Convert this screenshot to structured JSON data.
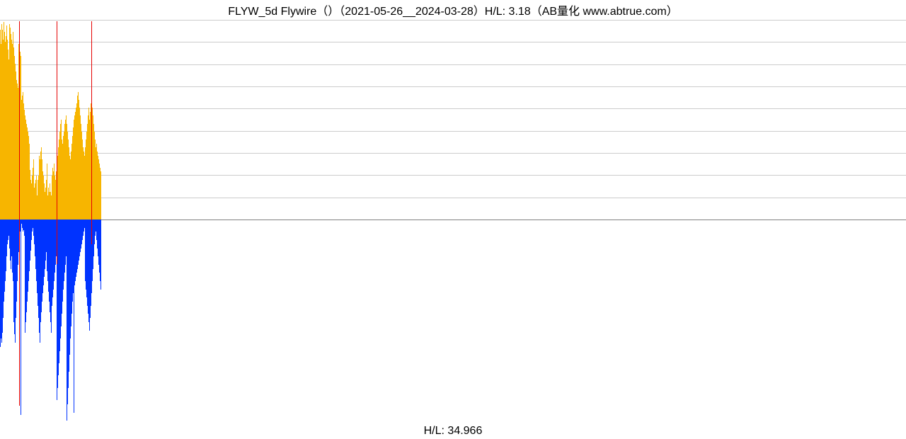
{
  "title": "FLYW_5d Flywire（）（2021-05-26__2024-03-28）H/L: 3.18（AB量化  www.abtrue.com）",
  "footer": "H/L: 34.966",
  "colors": {
    "up_bar": "#f7b500",
    "down_bar": "#0033ff",
    "mark": "#e60000",
    "grid": "#cccccc",
    "baseline": "#808080"
  },
  "chart_data": {
    "type": "bar",
    "title": "FLYW_5d Flywire（）（2021-05-26__2024-03-28）H/L: 3.18（AB量化  www.abtrue.com）",
    "xlabel": "",
    "ylabel": "",
    "hl_ratio_top": 3.18,
    "hl_ratio_bottom": 34.966,
    "grid_levels_upper": [
      0,
      0.111,
      0.222,
      0.333,
      0.444,
      0.556,
      0.667,
      0.778,
      0.889,
      1.0
    ],
    "x_range_bars": 148,
    "data_extent_bars": 143,
    "full_width_bars": 1280,
    "series": [
      {
        "name": "upper",
        "color": "#f7b500",
        "note": "column heights as fraction of upper-panel height; bars grow up from the midline",
        "values": [
          0.95,
          0.88,
          0.98,
          0.95,
          0.9,
          0.99,
          0.94,
          0.89,
          0.92,
          0.97,
          0.9,
          0.85,
          0.8,
          0.98,
          0.96,
          0.93,
          0.9,
          0.88,
          0.94,
          0.86,
          0.82,
          0.78,
          0.74,
          0.7,
          0.68,
          0.66,
          0.88,
          0.86,
          0.84,
          0.82,
          0.6,
          0.62,
          0.64,
          0.58,
          0.55,
          0.52,
          0.5,
          0.48,
          0.46,
          0.44,
          0.42,
          0.38,
          0.25,
          0.2,
          0.18,
          0.22,
          0.26,
          0.3,
          0.16,
          0.18,
          0.2,
          0.22,
          0.12,
          0.2,
          0.22,
          0.32,
          0.3,
          0.34,
          0.36,
          0.3,
          0.24,
          0.22,
          0.18,
          0.14,
          0.16,
          0.2,
          0.28,
          0.12,
          0.16,
          0.14,
          0.18,
          0.14,
          0.12,
          0.22,
          0.26,
          0.24,
          0.28,
          0.22,
          0.2,
          0.24,
          0.28,
          0.32,
          0.36,
          0.4,
          0.44,
          0.48,
          0.5,
          0.4,
          0.38,
          0.42,
          0.44,
          0.48,
          0.5,
          0.52,
          0.48,
          0.44,
          0.4,
          0.36,
          0.32,
          0.3,
          0.34,
          0.38,
          0.42,
          0.46,
          0.5,
          0.52,
          0.54,
          0.56,
          0.58,
          0.62,
          0.64,
          0.6,
          0.56,
          0.52,
          0.48,
          0.44,
          0.4,
          0.36,
          0.34,
          0.32,
          0.36,
          0.4,
          0.44,
          0.48,
          0.52,
          0.56,
          0.5,
          0.54,
          0.58,
          0.6,
          0.56,
          0.52,
          0.48,
          0.44,
          0.4,
          0.36,
          0.38,
          0.34,
          0.32,
          0.3,
          0.28,
          0.26,
          0.24
        ]
      },
      {
        "name": "lower",
        "color": "#0033ff",
        "note": "column depths as fraction of lower-panel height; bars hang down from the midline",
        "values": [
          0.62,
          0.58,
          0.6,
          0.55,
          0.48,
          0.4,
          0.35,
          0.3,
          0.25,
          0.18,
          0.12,
          0.1,
          0.08,
          0.14,
          0.2,
          0.24,
          0.18,
          0.26,
          0.3,
          0.5,
          0.56,
          0.6,
          0.48,
          0.4,
          0.3,
          0.22,
          0.16,
          0.12,
          0.06,
          0.95,
          0.02,
          0.04,
          0.06,
          0.05,
          0.08,
          0.55,
          0.5,
          0.45,
          0.4,
          0.35,
          0.3,
          0.25,
          0.2,
          0.15,
          0.1,
          0.06,
          0.04,
          0.08,
          0.12,
          0.18,
          0.24,
          0.3,
          0.36,
          0.42,
          0.48,
          0.55,
          0.6,
          0.5,
          0.45,
          0.4,
          0.36,
          0.32,
          0.28,
          0.24,
          0.2,
          0.16,
          0.25,
          0.3,
          0.35,
          0.4,
          0.45,
          0.5,
          0.55,
          0.42,
          0.38,
          0.34,
          0.3,
          0.26,
          0.22,
          0.18,
          0.88,
          0.82,
          0.76,
          0.7,
          0.64,
          0.58,
          0.52,
          0.46,
          0.4,
          0.34,
          0.3,
          0.26,
          0.22,
          0.18,
          0.98,
          0.9,
          0.82,
          0.74,
          0.66,
          0.58,
          0.52,
          0.46,
          0.4,
          0.36,
          0.94,
          0.32,
          0.3,
          0.28,
          0.26,
          0.24,
          0.22,
          0.2,
          0.18,
          0.16,
          0.14,
          0.12,
          0.1,
          0.08,
          0.06,
          0.04,
          0.3,
          0.34,
          0.38,
          0.42,
          0.46,
          0.5,
          0.54,
          0.48,
          0.42,
          0.36,
          0.3,
          0.24,
          0.18,
          0.12,
          0.08,
          0.06,
          0.1,
          0.14,
          0.18,
          0.22,
          0.26,
          0.3,
          0.34
        ]
      },
      {
        "name": "marks",
        "color": "#e60000",
        "note": "indices where a red marker line appears, with fraction of full chart height (top-to-bottom extent)",
        "indices": [
          27,
          80,
          129
        ],
        "extent": [
          0.95,
          0.6,
          0.55
        ]
      }
    ]
  }
}
